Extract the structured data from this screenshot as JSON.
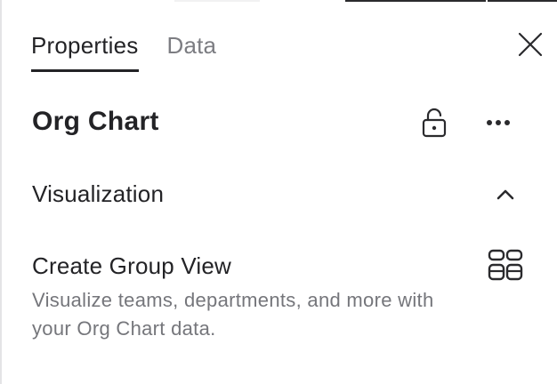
{
  "tabs": [
    {
      "label": "Properties",
      "active": true
    },
    {
      "label": "Data",
      "active": false
    }
  ],
  "header": {
    "title": "Org Chart"
  },
  "icons": {
    "close": "close-icon",
    "lock": "unlock-icon",
    "more": "more-horizontal-icon",
    "collapse": "chevron-up-icon",
    "group_view": "grid-layout-icon"
  },
  "section": {
    "label": "Visualization",
    "expanded": true
  },
  "group_view": {
    "title": "Create Group View",
    "description": "Visualize teams, departments, and more with your Org Chart data."
  },
  "colors": {
    "text_primary": "#232326",
    "text_secondary": "#75767b",
    "border": "#e4e4e6"
  }
}
